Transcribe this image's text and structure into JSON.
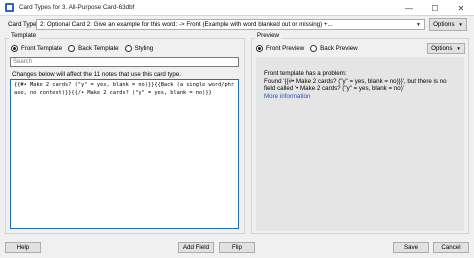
{
  "window": {
    "title": "Card Types for 3. All-Purpose Card-63dbf",
    "minimize": "—",
    "maximize": "☐",
    "close": "✕"
  },
  "card_type": {
    "label": "Card Type:",
    "selected": "2: Optional Card 2: Give an example for this word:  -> Front (Example with word blanked out or missing) +...",
    "options_label": "Options"
  },
  "template": {
    "group_title": "Template",
    "radios": {
      "front": "Front Template",
      "back": "Back Template",
      "styling": "Styling"
    },
    "search_placeholder": "Search",
    "info": "Changes below will affect the 11 notes that use this card type.",
    "editor_content": "{{#• Make 2 cards? (\"y\" = yes, blank = no)}}{{Back (a single word/phrase, no context)}}{{/• Make 2 cards? (\"y\" = yes, blank = no)}}"
  },
  "preview": {
    "group_title": "Preview",
    "radios": {
      "front": "Front Preview",
      "back": "Back Preview"
    },
    "options_label": "Options",
    "problem_line": "Front template has a problem:",
    "detail": "Found '{{#• Make 2 cards? (\"y\" = yes, blank = no)}}', but there is no field called '• Make 2 cards? (\"y\" = yes, blank = no)'",
    "more_info": "More information"
  },
  "buttons": {
    "help": "Help",
    "add_field": "Add Field",
    "flip": "Flip",
    "save": "Save",
    "cancel": "Cancel"
  }
}
